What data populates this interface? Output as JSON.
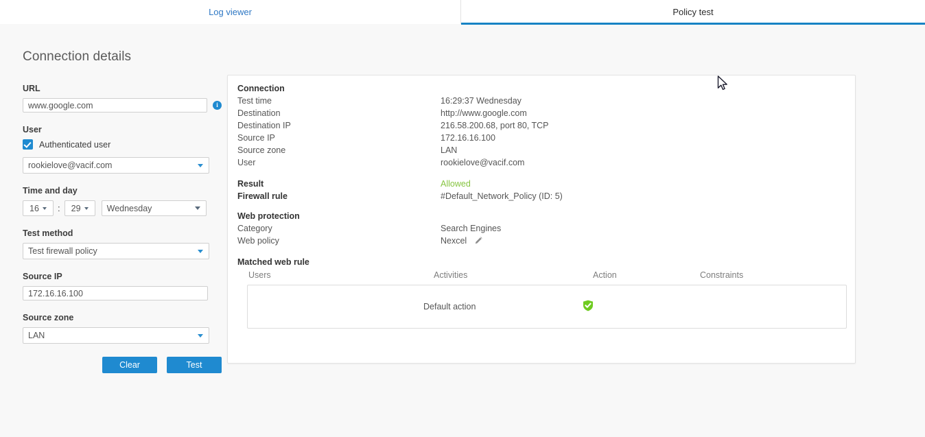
{
  "tabs": [
    {
      "id": "log-viewer",
      "label": "Log viewer",
      "active": false
    },
    {
      "id": "policy-test",
      "label": "Policy test",
      "active": true
    }
  ],
  "form": {
    "title": "Connection details",
    "url": {
      "label": "URL",
      "value": "www.google.com",
      "placeholder": "www.google.com",
      "info_icon": "info-icon"
    },
    "user": {
      "label": "User",
      "checkbox_label": "Authenticated user",
      "checked": true,
      "selected_user": "rookielove@vacif.com"
    },
    "time_and_day": {
      "label": "Time and day",
      "hour": "16",
      "minute": "29",
      "separator": ":",
      "day": "Wednesday"
    },
    "test_method": {
      "label": "Test method",
      "value": "Test firewall policy"
    },
    "source_ip": {
      "label": "Source IP",
      "value": "172.16.16.100",
      "placeholder": "172.16.16.100"
    },
    "source_zone": {
      "label": "Source zone",
      "value": "LAN"
    },
    "buttons": {
      "clear": "Clear",
      "test": "Test"
    }
  },
  "results": {
    "connection": {
      "heading": "Connection",
      "rows": [
        {
          "key": "Test time",
          "value": "16:29:37 Wednesday"
        },
        {
          "key": "Destination",
          "value": "http://www.google.com"
        },
        {
          "key": "Destination IP",
          "value": "216.58.200.68, port 80, TCP"
        },
        {
          "key": "Source IP",
          "value": "172.16.16.100"
        },
        {
          "key": "Source zone",
          "value": "LAN"
        },
        {
          "key": "User",
          "value": "rookielove@vacif.com"
        }
      ]
    },
    "result": {
      "key": "Result",
      "value": "Allowed",
      "color": "#86c440"
    },
    "firewall_rule": {
      "key": "Firewall rule",
      "value": "#Default_Network_Policy (ID: 5)"
    },
    "web_protection": {
      "heading": "Web protection",
      "rows": [
        {
          "key": "Category",
          "value": "Search Engines"
        },
        {
          "key": "Web policy",
          "value": "Nexcel",
          "edit_icon": "pencil-icon"
        }
      ]
    },
    "matched_web_rule": {
      "heading": "Matched web rule",
      "columns": [
        "Users",
        "Activities",
        "Action",
        "Constraints"
      ],
      "rows": [
        {
          "users": "",
          "activities": "Default action",
          "action_icon": "shield-check-icon",
          "action_color": "#6fcb21",
          "constraints": ""
        }
      ]
    }
  },
  "colors": {
    "accent": "#1f8ad0",
    "tab_link": "#2f78c4",
    "allowed_green": "#86c440",
    "shield_green": "#6fcb21"
  }
}
